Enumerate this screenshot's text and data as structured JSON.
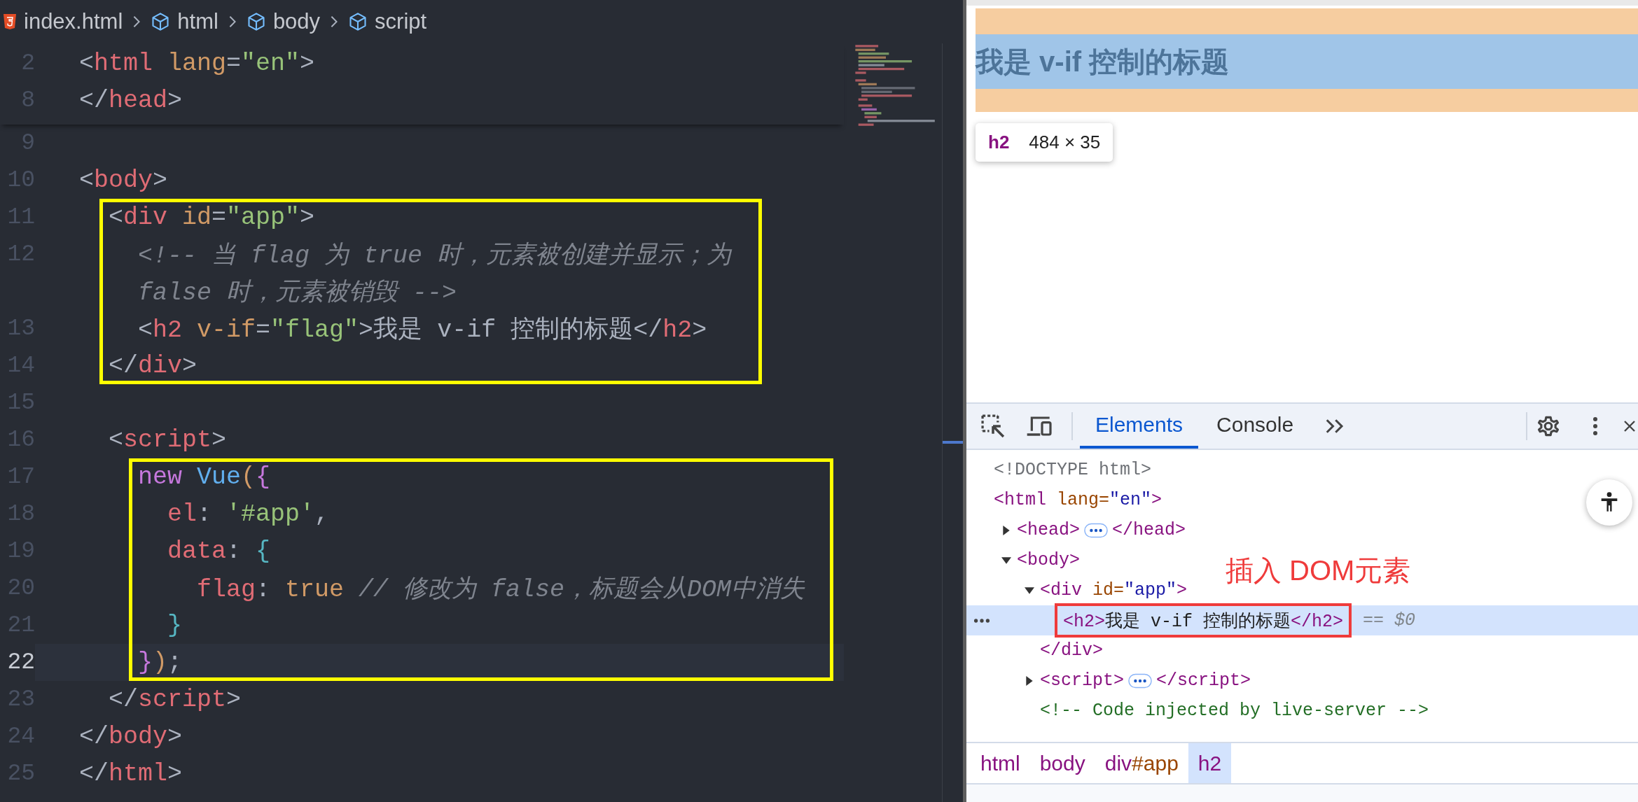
{
  "editor": {
    "breadcrumbs": [
      {
        "label": "index.html",
        "kind": "file"
      },
      {
        "label": "html",
        "kind": "element"
      },
      {
        "label": "body",
        "kind": "element"
      },
      {
        "label": "script",
        "kind": "element"
      }
    ],
    "sticky_lines": [
      {
        "number": "2",
        "current": false,
        "rows": [
          [
            {
              "text": "<",
              "kind": "punct"
            },
            {
              "text": "html",
              "kind": "tag"
            },
            {
              "text": " lang",
              "kind": "attr"
            },
            {
              "text": "=",
              "kind": "punct"
            },
            {
              "text": "\"en\"",
              "kind": "string"
            },
            {
              "text": ">",
              "kind": "punct"
            }
          ]
        ]
      },
      {
        "number": "8",
        "current": false,
        "rows": [
          [
            {
              "text": "</",
              "kind": "punct"
            },
            {
              "text": "head",
              "kind": "tag"
            },
            {
              "text": ">",
              "kind": "punct"
            }
          ]
        ]
      }
    ],
    "blocks": [
      {
        "framed": false,
        "lines": [
          {
            "number": "9",
            "current": false
          },
          {
            "number": "10",
            "current": false,
            "rows": [
              [
                {
                  "text": "<",
                  "kind": "punct"
                },
                {
                  "text": "body",
                  "kind": "tag"
                },
                {
                  "text": ">",
                  "kind": "punct"
                }
              ]
            ]
          }
        ]
      },
      {
        "framed": true,
        "lines": [
          {
            "number": "11",
            "current": false,
            "rows": [
              [
                {
                  "text": "  <",
                  "kind": "punct"
                },
                {
                  "text": "div",
                  "kind": "tag"
                },
                {
                  "text": " id",
                  "kind": "attr"
                },
                {
                  "text": "=",
                  "kind": "punct"
                },
                {
                  "text": "\"app\"",
                  "kind": "string"
                },
                {
                  "text": ">",
                  "kind": "punct"
                }
              ]
            ]
          },
          {
            "number": "12",
            "current": false,
            "rows": [
              [
                {
                  "text": "    <!-- 当 flag 为 true 时，元素被创建并显示；为",
                  "kind": "comment"
                }
              ],
              [
                {
                  "text": "    false 时，元素被销毁 -->",
                  "kind": "comment"
                }
              ]
            ]
          },
          {
            "number": "13",
            "current": false,
            "rows": [
              [
                {
                  "text": "    <",
                  "kind": "punct"
                },
                {
                  "text": "h2",
                  "kind": "tag"
                },
                {
                  "text": " v-if",
                  "kind": "attr"
                },
                {
                  "text": "=",
                  "kind": "punct"
                },
                {
                  "text": "\"flag\"",
                  "kind": "string"
                },
                {
                  "text": ">",
                  "kind": "punct"
                },
                {
                  "text": "我是 v-if 控制的标题",
                  "kind": "text"
                },
                {
                  "text": "</",
                  "kind": "punct"
                },
                {
                  "text": "h2",
                  "kind": "tag"
                },
                {
                  "text": ">",
                  "kind": "punct"
                }
              ]
            ]
          },
          {
            "number": "14",
            "current": false,
            "rows": [
              [
                {
                  "text": "  </",
                  "kind": "punct"
                },
                {
                  "text": "div",
                  "kind": "tag"
                },
                {
                  "text": ">",
                  "kind": "punct"
                }
              ]
            ]
          }
        ]
      },
      {
        "framed": false,
        "lines": [
          {
            "number": "15",
            "current": false
          },
          {
            "number": "16",
            "current": false,
            "rows": [
              [
                {
                  "text": "  <",
                  "kind": "punct"
                },
                {
                  "text": "script",
                  "kind": "tag"
                },
                {
                  "text": ">",
                  "kind": "punct"
                }
              ]
            ]
          }
        ]
      },
      {
        "framed": true,
        "lines": [
          {
            "number": "17",
            "current": false,
            "rows": [
              [
                {
                  "text": "    new",
                  "kind": "keyword"
                },
                {
                  "text": " Vue",
                  "kind": "class"
                },
                {
                  "text": "(",
                  "kind": "paren"
                },
                {
                  "text": "{",
                  "kind": "brace_outer"
                }
              ]
            ]
          },
          {
            "number": "18",
            "current": false,
            "rows": [
              [
                {
                  "text": "      el",
                  "kind": "property"
                },
                {
                  "text": ": ",
                  "kind": "punct"
                },
                {
                  "text": "'#app'",
                  "kind": "string"
                },
                {
                  "text": ",",
                  "kind": "punct"
                }
              ]
            ]
          },
          {
            "number": "19",
            "current": false,
            "rows": [
              [
                {
                  "text": "      data",
                  "kind": "property"
                },
                {
                  "text": ": ",
                  "kind": "punct"
                },
                {
                  "text": "{",
                  "kind": "brace_inner"
                }
              ]
            ]
          },
          {
            "number": "20",
            "current": false,
            "rows": [
              [
                {
                  "text": "        flag",
                  "kind": "property"
                },
                {
                  "text": ": ",
                  "kind": "punct"
                },
                {
                  "text": "true",
                  "kind": "bool"
                },
                {
                  "text": " // 修改为 false，标题会从DOM中消失",
                  "kind": "comment"
                }
              ]
            ]
          },
          {
            "number": "21",
            "current": false,
            "rows": [
              [
                {
                  "text": "      }",
                  "kind": "brace_inner"
                }
              ]
            ]
          },
          {
            "number": "22",
            "current": true,
            "rows": [
              [
                {
                  "text": "    }",
                  "kind": "brace_outer"
                },
                {
                  "text": ")",
                  "kind": "paren"
                },
                {
                  "text": ";",
                  "kind": "punct"
                }
              ]
            ]
          }
        ]
      },
      {
        "framed": false,
        "lines": [
          {
            "number": "23",
            "current": false,
            "rows": [
              [
                {
                  "text": "  </",
                  "kind": "punct"
                },
                {
                  "text": "script",
                  "kind": "tag"
                },
                {
                  "text": ">",
                  "kind": "punct"
                }
              ]
            ]
          },
          {
            "number": "24",
            "current": false,
            "rows": [
              [
                {
                  "text": "</",
                  "kind": "punct"
                },
                {
                  "text": "body",
                  "kind": "tag"
                },
                {
                  "text": ">",
                  "kind": "punct"
                }
              ]
            ]
          },
          {
            "number": "25",
            "current": false,
            "rows": [
              [
                {
                  "text": "</",
                  "kind": "punct"
                },
                {
                  "text": "html",
                  "kind": "tag"
                },
                {
                  "text": ">",
                  "kind": "punct"
                }
              ]
            ]
          }
        ]
      }
    ]
  },
  "page": {
    "heading": "我是 v-if 控制的标题",
    "tooltip": {
      "tag": "h2",
      "size": "484 × 35"
    }
  },
  "devtools": {
    "tabs": [
      {
        "label": "Elements",
        "selected": true
      },
      {
        "label": "Console",
        "selected": false
      }
    ],
    "tree": [
      {
        "selected": false,
        "tokens": [
          {
            "text": "<!DOCTYPE html>",
            "kind": "doctype"
          }
        ]
      },
      {
        "selected": false,
        "tokens": [
          {
            "text": "<html",
            "kind": "tag"
          },
          {
            "text": " lang=",
            "kind": "attr"
          },
          {
            "text": "\"en\"",
            "kind": "value"
          },
          {
            "text": ">",
            "kind": "tag"
          }
        ],
        "children": [
          {
            "selected": false,
            "expanded": false,
            "tokens": [
              {
                "text": "<head>",
                "kind": "tag"
              },
              {
                "kind": "badge"
              },
              {
                "text": "</head>",
                "kind": "tag"
              }
            ]
          },
          {
            "selected": false,
            "expanded": true,
            "tokens": [
              {
                "text": "<body>",
                "kind": "tag"
              }
            ],
            "children": [
              {
                "selected": false,
                "expanded": true,
                "tokens": [
                  {
                    "text": "<div",
                    "kind": "tag"
                  },
                  {
                    "text": " id=",
                    "kind": "attr"
                  },
                  {
                    "text": "\"app\"",
                    "kind": "value"
                  },
                  {
                    "text": ">",
                    "kind": "tag"
                  }
                ],
                "closing": [
                  {
                    "text": "</div>",
                    "kind": "tag"
                  }
                ],
                "children": [
                  {
                    "selected": true,
                    "marked": true,
                    "console_ref": "== $0",
                    "tokens": [
                      {
                        "text": "<h2>",
                        "kind": "tag"
                      },
                      {
                        "text": "我是 v-if 控制的标题",
                        "kind": "text"
                      },
                      {
                        "text": "</h2>",
                        "kind": "tag"
                      }
                    ]
                  }
                ]
              },
              {
                "selected": false,
                "expanded": false,
                "tokens": [
                  {
                    "text": "<script>",
                    "kind": "tag"
                  },
                  {
                    "kind": "badge"
                  },
                  {
                    "text": "</script>",
                    "kind": "tag"
                  }
                ]
              },
              {
                "selected": false,
                "tokens": [
                  {
                    "text": "<!-- Code injected by live-server -->",
                    "kind": "comment"
                  }
                ]
              }
            ]
          }
        ]
      }
    ],
    "annotation": "插入 DOM元素",
    "crumbs": [
      {
        "selected": false,
        "parts": [
          {
            "text": "html",
            "kind": "tag"
          }
        ]
      },
      {
        "selected": false,
        "parts": [
          {
            "text": "body",
            "kind": "tag"
          }
        ]
      },
      {
        "selected": false,
        "parts": [
          {
            "text": "div",
            "kind": "tag"
          },
          {
            "text": "#app",
            "kind": "id"
          }
        ]
      },
      {
        "selected": true,
        "parts": [
          {
            "text": "h2",
            "kind": "tag"
          }
        ]
      }
    ]
  }
}
